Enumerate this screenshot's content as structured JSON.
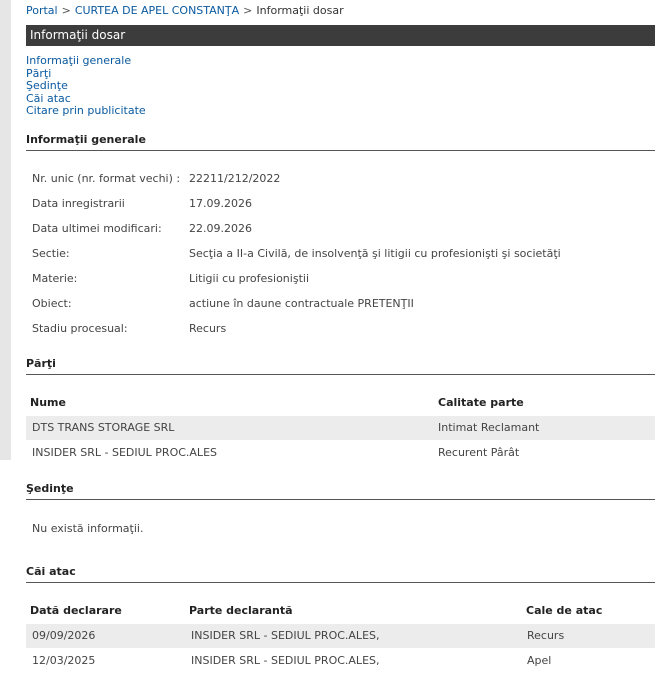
{
  "breadcrumb": {
    "items": [
      "Portal",
      "CURTEA DE APEL CONSTANŢA",
      "Informaţii dosar"
    ],
    "sep": ">"
  },
  "title": "Informaţii dosar",
  "toc": [
    "Informaţii generale",
    "Părţi",
    "Şedinţe",
    "Căi atac",
    "Citare prin publicitate"
  ],
  "general": {
    "heading": "Informaţii generale",
    "rows": [
      {
        "label": "Nr. unic (nr. format vechi) :",
        "value": "22211/212/2022"
      },
      {
        "label": "Data inregistrarii",
        "value": "17.09.2026"
      },
      {
        "label": "Data ultimei modificari:",
        "value": "22.09.2026"
      },
      {
        "label": "Sectie:",
        "value": "Secţia a II-a Civilă, de insolvenţă şi litigii cu profesionişti şi societăţi"
      },
      {
        "label": "Materie:",
        "value": "Litigii cu profesioniştii"
      },
      {
        "label": "Obiect:",
        "value": "actiune în daune contractuale PRETENŢII"
      },
      {
        "label": "Stadiu procesual:",
        "value": "Recurs"
      }
    ]
  },
  "parti": {
    "heading": "Părţi",
    "headers": [
      "Nume",
      "Calitate parte"
    ],
    "rows": [
      [
        "DTS TRANS STORAGE SRL",
        "Intimat Reclamant"
      ],
      [
        "INSIDER SRL - SEDIUL PROC.ALES",
        "Recurent Pârât"
      ]
    ]
  },
  "sedinte": {
    "heading": "Şedinţe",
    "empty": "Nu există informaţii."
  },
  "cai_atac": {
    "heading": "Căi atac",
    "headers": [
      "Dată declarare",
      "Parte declarantă",
      "Cale de atac"
    ],
    "rows": [
      [
        "09/09/2026",
        "INSIDER SRL - SEDIUL PROC.ALES,",
        "Recurs"
      ],
      [
        "12/03/2025",
        "INSIDER SRL - SEDIUL PROC.ALES,",
        "Apel"
      ]
    ]
  }
}
